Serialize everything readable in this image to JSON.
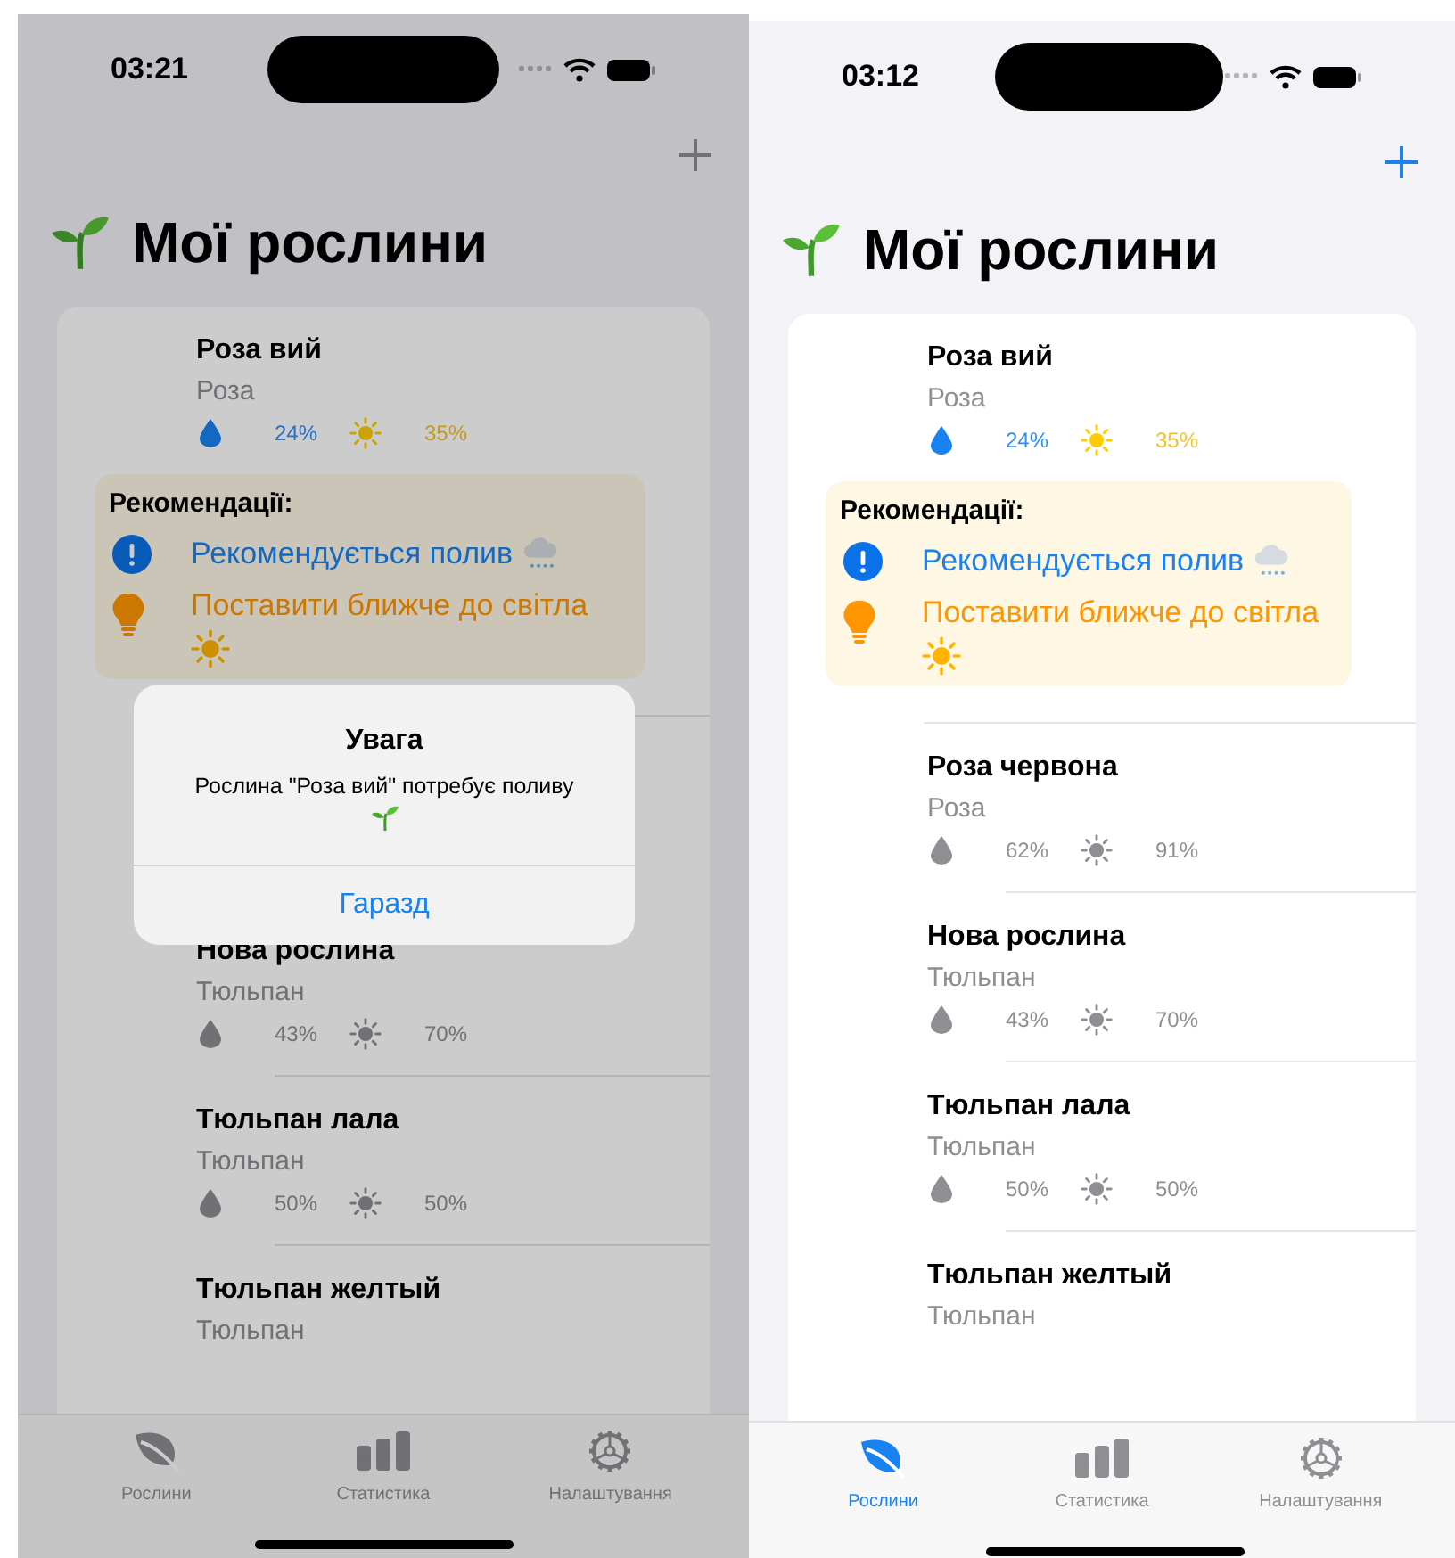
{
  "screens": [
    {
      "time": "03:21",
      "dimmed": true,
      "title": "Мої рослини",
      "plants": [
        {
          "name": "Роза вий",
          "species": "Роза",
          "moisture": "24%",
          "light": "35%",
          "highlighted": true,
          "recommendations_title": "Рекомендації:",
          "recommendations": [
            {
              "kind": "water",
              "text": "Рекомендується полив"
            },
            {
              "kind": "light",
              "text": "Поставити ближче до світла"
            }
          ]
        },
        {
          "kind": "covered"
        },
        {
          "name": "Нова рослина",
          "species": "Тюльпан",
          "moisture": "43%",
          "light": "70%",
          "highlighted": false
        },
        {
          "name": "Тюльпан лала",
          "species": "Тюльпан",
          "moisture": "50%",
          "light": "50%",
          "highlighted": false
        },
        {
          "name": "Тюльпан желтый",
          "species": "Тюльпан"
        }
      ],
      "alert": {
        "title": "Увага",
        "message": "Рослина \"Роза вий\" потребує поливу",
        "button": "Гаразд"
      },
      "tabs": [
        {
          "label": "Рослини"
        },
        {
          "label": "Статистика"
        },
        {
          "label": "Налаштування"
        }
      ]
    },
    {
      "time": "03:12",
      "title": "Мої рослини",
      "plants": [
        {
          "name": "Роза вий",
          "species": "Роза",
          "moisture": "24%",
          "light": "35%",
          "highlighted": true,
          "recommendations_title": "Рекомендації:",
          "recommendations": [
            {
              "kind": "water",
              "text": "Рекомендується полив"
            },
            {
              "kind": "light",
              "text": "Поставити ближче до світла"
            }
          ]
        },
        {
          "name": "Роза червона",
          "species": "Роза",
          "moisture": "62%",
          "light": "91%",
          "highlighted": false
        },
        {
          "name": "Нова рослина",
          "species": "Тюльпан",
          "moisture": "43%",
          "light": "70%",
          "highlighted": false
        },
        {
          "name": "Тюльпан лала",
          "species": "Тюльпан",
          "moisture": "50%",
          "light": "50%",
          "highlighted": false
        },
        {
          "name": "Тюльпан желтый",
          "species": "Тюльпан"
        }
      ],
      "tabs": [
        {
          "label": "Рослини",
          "selected": true
        },
        {
          "label": "Статистика",
          "selected": false
        },
        {
          "label": "Налаштування",
          "selected": false
        }
      ]
    }
  ]
}
